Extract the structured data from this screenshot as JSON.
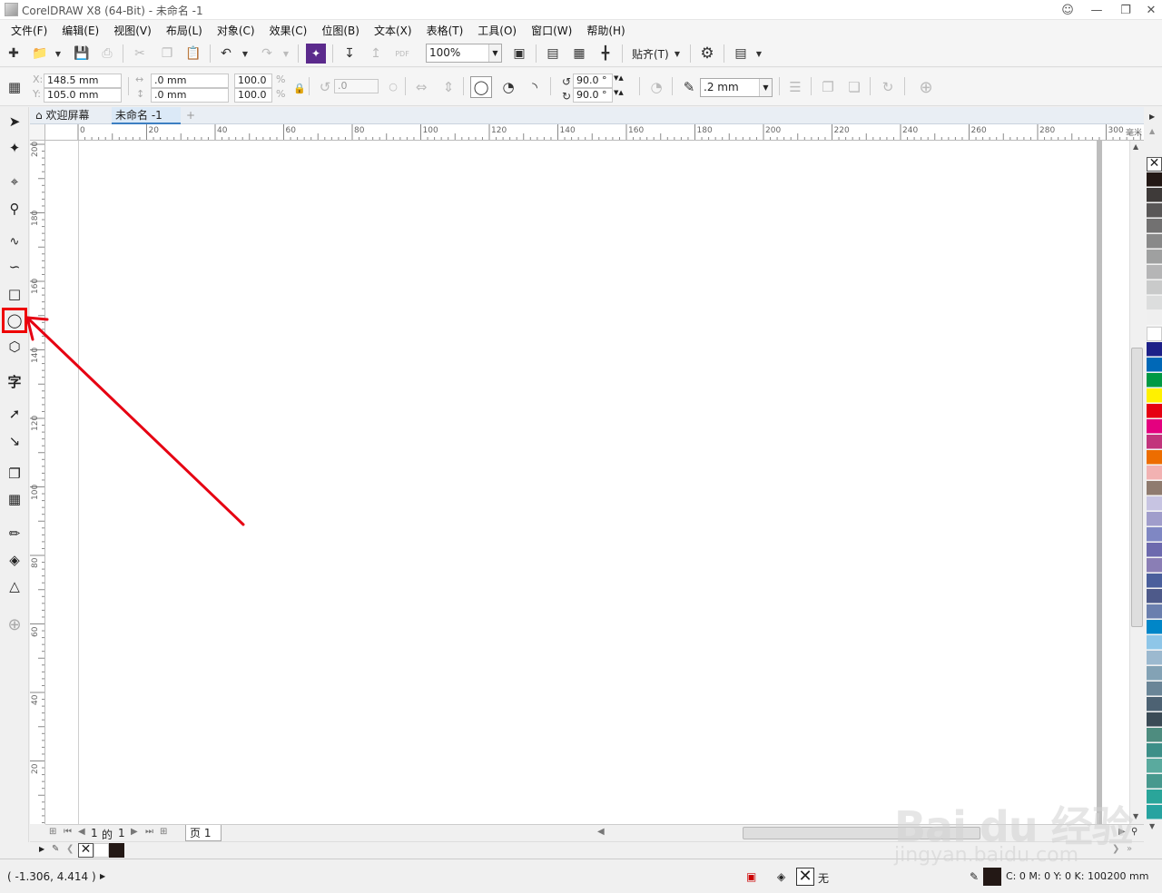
{
  "window": {
    "title": "CorelDRAW X8 (64-Bit) - 未命名 -1"
  },
  "menu": [
    "文件(F)",
    "编辑(E)",
    "视图(V)",
    "布局(L)",
    "对象(C)",
    "效果(C)",
    "位图(B)",
    "文本(X)",
    "表格(T)",
    "工具(O)",
    "窗口(W)",
    "帮助(H)"
  ],
  "toolbar": {
    "zoom": "100%",
    "snap_label": "贴齐(T)",
    "pdf_label": "PDF"
  },
  "property_bar": {
    "x": "148.5 mm",
    "y": "105.0 mm",
    "x_label": "X:",
    "y_label": "Y:",
    "width": ".0 mm",
    "height": ".0 mm",
    "scale_w": "100.0",
    "scale_h": "100.0",
    "percent": "%",
    "rotation": ".0",
    "start_angle": "90.0 °",
    "end_angle": "90.0 °",
    "outline_width": ".2 mm"
  },
  "tabs": {
    "welcome": "欢迎屏幕",
    "document": "未命名 -1"
  },
  "rulers": {
    "horizontal": [
      "0",
      "20",
      "40",
      "60",
      "80",
      "100",
      "120",
      "140",
      "160",
      "180",
      "200",
      "220",
      "240",
      "260",
      "280",
      "300"
    ],
    "horizontal_unit": "毫米",
    "vertical": [
      "200",
      "180",
      "160",
      "140",
      "120",
      "100",
      "80",
      "60",
      "40",
      "20"
    ]
  },
  "page_nav": {
    "current": "1",
    "of": "的",
    "total": "1",
    "page_tab": "页 1"
  },
  "status": {
    "coords": "( -1.306, 4.414 )",
    "fill": "无",
    "outline_color": "C: 0 M: 0 Y: 0 K: 100",
    "outline_width": ".200 mm"
  },
  "palette": {
    "colors": [
      "#231815",
      "#3e3a39",
      "#595757",
      "#727171",
      "#898989",
      "#9fa0a0",
      "#b5b5b6",
      "#c9caca",
      "#dcdddd",
      "#efefef",
      "#ffffff",
      "#1d2088",
      "#0068b7",
      "#009944",
      "#fff100",
      "#e60012",
      "#e4007f",
      "#c2347c",
      "#ed6d00",
      "#f2b2b2",
      "#8f7b6f",
      "#c7c4e2",
      "#a09dcb",
      "#7f87c3",
      "#6d6aae",
      "#8a7eb5",
      "#4a5f9c",
      "#4e5a8a",
      "#6a7fae",
      "#0086c8",
      "#8ec6e8",
      "#9cb9cf",
      "#83a2b5",
      "#6a8597",
      "#4d6273",
      "#3b4b56",
      "#4e8c7f",
      "#3d8f88",
      "#5aaa9e",
      "#47998e",
      "#2aa59a",
      "#27a3a0"
    ]
  },
  "watermark": {
    "logo": "Bai du 经验",
    "url": "jingyan.baidu.com"
  },
  "accent_colors": {
    "annotation": "#e60012"
  }
}
